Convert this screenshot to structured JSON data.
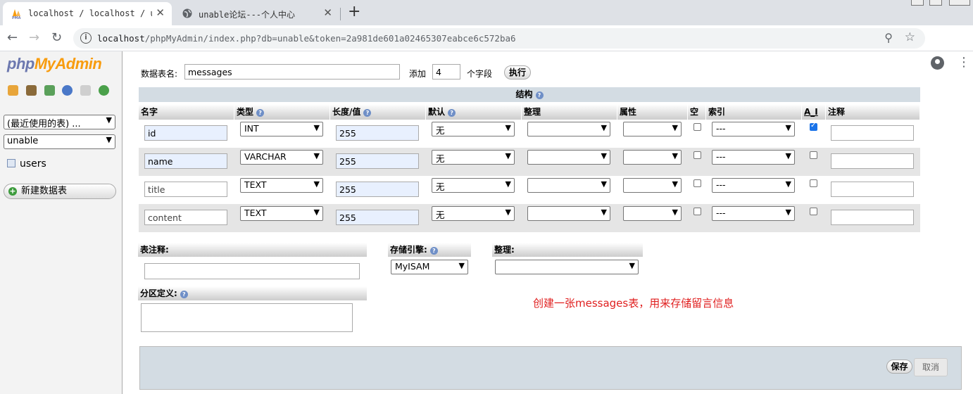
{
  "browser": {
    "tabs": [
      {
        "title": "localhost / localhost / unable",
        "active": true
      },
      {
        "title": "unable论坛---个人中心",
        "active": false
      }
    ],
    "url_host": "localhost",
    "url_rest": "/phpMyAdmin/index.php?db=unable&token=2a981de601a02465307eabce6c572ba6"
  },
  "sidebar": {
    "logo_php": "php",
    "logo_myadmin": "MyAdmin",
    "recent_select": "(最近使用的表) ...",
    "db_select": "unable",
    "tables": [
      "users"
    ],
    "new_table": "新建数据表"
  },
  "form": {
    "table_name_label": "数据表名:",
    "table_name_value": "messages",
    "add_label": "添加",
    "add_count": "4",
    "fields_label": "个字段",
    "go_button": "执行",
    "structure_title": "结构",
    "columns": [
      "名字",
      "类型",
      "长度/值",
      "默认",
      "整理",
      "属性",
      "空",
      "索引",
      "A_I",
      "注释"
    ],
    "rows": [
      {
        "name": "id",
        "type": "INT",
        "length": "255",
        "default": "无",
        "index": "---",
        "ai": true
      },
      {
        "name": "name",
        "type": "VARCHAR",
        "length": "255",
        "default": "无",
        "index": "---",
        "ai": false
      },
      {
        "name": "title",
        "type": "TEXT",
        "length": "255",
        "default": "无",
        "index": "---",
        "ai": false
      },
      {
        "name": "content",
        "type": "TEXT",
        "length": "255",
        "default": "无",
        "index": "---",
        "ai": false
      }
    ],
    "table_comment_label": "表注释:",
    "engine_label": "存储引擎:",
    "engine_value": "MyISAM",
    "collation_label": "整理:",
    "partition_label": "分区定义:",
    "annotation": "创建一张messages表，用来存储留言信息",
    "save_button": "保存",
    "cancel_button": "取消"
  },
  "colors": {
    "header_bg": "#d3dce3",
    "annotation": "#e02020",
    "logo_php": "#6c78af",
    "logo_myadmin": "#f89c0e"
  }
}
